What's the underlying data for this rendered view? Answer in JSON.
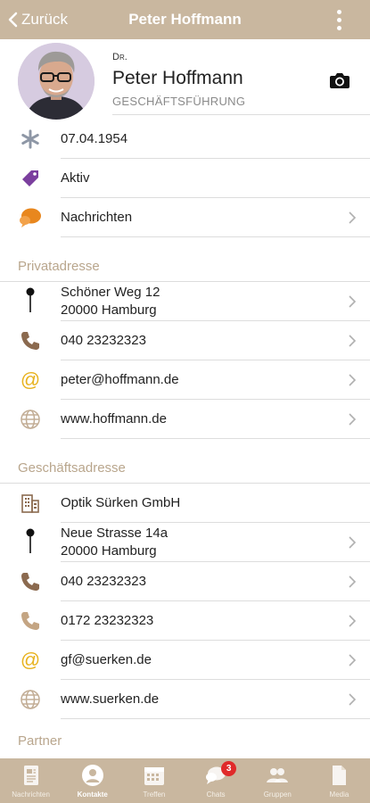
{
  "header": {
    "back_label": "Zurück",
    "title": "Peter Hoffmann",
    "menu_icon": "more-vertical-icon"
  },
  "profile": {
    "prefix": "Dr.",
    "name": "Peter Hoffmann",
    "role": "GESCHÄFTSFÜHRUNG",
    "camera_icon": "camera-icon"
  },
  "info": {
    "birthday": "07.04.1954",
    "status": "Aktiv",
    "messages": "Nachrichten"
  },
  "private": {
    "section_label": "Privatadresse",
    "street": "Schöner Weg 12",
    "city": "20000 Hamburg",
    "phone": "040 23232323",
    "email": "peter@hoffmann.de",
    "web": "www.hoffmann.de"
  },
  "business": {
    "section_label": "Geschäftsadresse",
    "company": "Optik Sürken GmbH",
    "street": "Neue Strasse 14a",
    "city": "20000 Hamburg",
    "phone": "040 23232323",
    "mobile": "0172 23232323",
    "email": "gf@suerken.de",
    "web": "www.suerken.de"
  },
  "partner": {
    "section_label": "Partner"
  },
  "colors": {
    "brand": "#c9b79f",
    "section_text": "#b9a68d",
    "badge": "#e02a2a",
    "tag": "#7b3f9e",
    "chat": "#e8871e",
    "email": "#e8b21e"
  },
  "tabs": [
    {
      "label": "Nachrichten",
      "icon": "newspaper-icon"
    },
    {
      "label": "Kontakte",
      "icon": "contacts-icon",
      "active": true
    },
    {
      "label": "Treffen",
      "icon": "calendar-icon"
    },
    {
      "label": "Chats",
      "icon": "chat-icon",
      "badge": "3"
    },
    {
      "label": "Gruppen",
      "icon": "groups-icon"
    },
    {
      "label": "Media",
      "icon": "document-icon"
    }
  ]
}
